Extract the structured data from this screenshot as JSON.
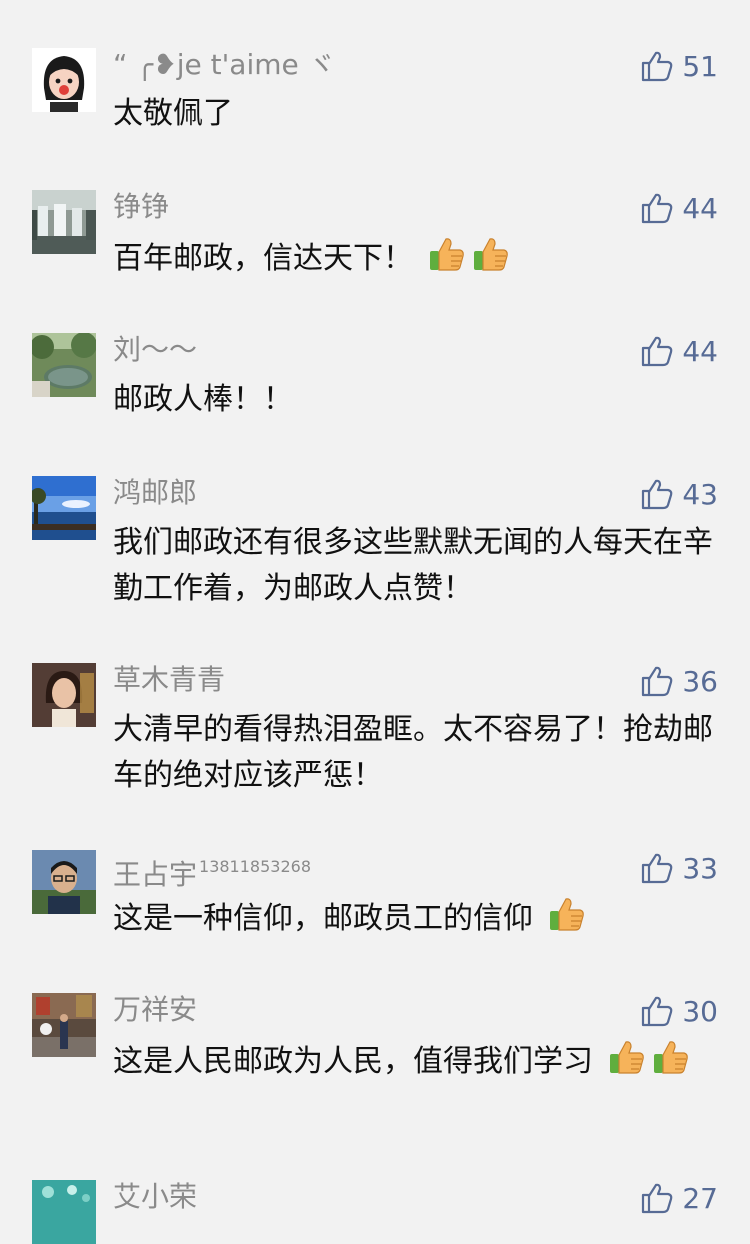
{
  "comments": [
    {
      "name": "“ ╭❥je t'aime ヾ",
      "name_sup": "",
      "likes": "51",
      "text": "太敬佩了",
      "emoji_count": 0,
      "emoji_after_text": false
    },
    {
      "name": "铮铮",
      "name_sup": "",
      "likes": "44",
      "text": "百年邮政，信达天下！",
      "emoji_count": 2,
      "emoji_after_text": true
    },
    {
      "name": "刘～～",
      "name_sup": "",
      "likes": "44",
      "text": "邮政人棒！！",
      "emoji_count": 0,
      "emoji_after_text": false
    },
    {
      "name": "鸿邮郎",
      "name_sup": "",
      "likes": "43",
      "text": "我们邮政还有很多这些默默无闻的人每天在辛勤工作着，为邮政人点赞！",
      "emoji_count": 0,
      "emoji_after_text": false
    },
    {
      "name": "草木青青",
      "name_sup": "",
      "likes": "36",
      "text": "大清早的看得热泪盈眶。太不容易了！抢劫邮车的绝对应该严惩！",
      "emoji_count": 0,
      "emoji_after_text": false
    },
    {
      "name": "王占宇",
      "name_sup": "13811853268",
      "likes": "33",
      "text": "这是一种信仰，邮政员工的信仰",
      "emoji_count": 1,
      "emoji_after_text": true
    },
    {
      "name": "万祥安",
      "name_sup": "",
      "likes": "30",
      "text": "这是人民邮政为人民，值得我们学习",
      "emoji_count": 2,
      "emoji_after_text": true
    },
    {
      "name": "艾小荣",
      "name_sup": "",
      "likes": "27",
      "text": "",
      "emoji_count": 0,
      "emoji_after_text": false
    }
  ],
  "icons": {
    "like": "thumbs-up-outline-icon",
    "emoji": "thumbs-up-emoji-icon"
  },
  "colors": {
    "link": "#576b95",
    "name": "#8a8a8a",
    "background": "#f2f2f2",
    "text": "#111111"
  }
}
